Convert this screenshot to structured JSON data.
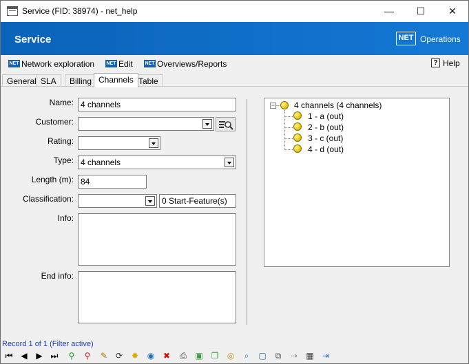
{
  "window": {
    "title": "Service (FID: 38974) - net_help",
    "minimize": "—",
    "maximize": "☐",
    "close": "✕"
  },
  "header": {
    "title": "Service",
    "logo_text": "NET",
    "product": "Operations",
    "colors": {
      "banner": "#0a63b8"
    }
  },
  "menu": {
    "items": [
      {
        "badge": "NET",
        "label": "Network exploration"
      },
      {
        "badge": "NET",
        "label": "Edit"
      },
      {
        "badge": "NET",
        "label": "Overviews/Reports"
      }
    ],
    "help_icon": "?",
    "help_label": "Help"
  },
  "tabs": [
    "General",
    "SLA",
    "Billing",
    "Channels",
    "Table"
  ],
  "active_tab": "Channels",
  "form": {
    "name": {
      "label": "Name:",
      "value": "4 channels"
    },
    "customer": {
      "label": "Customer:",
      "value": ""
    },
    "rating": {
      "label": "Rating:",
      "value": ""
    },
    "type": {
      "label": "Type:",
      "value": "4 channels"
    },
    "length": {
      "label": "Length (m):",
      "value": "84"
    },
    "classification": {
      "label": "Classification:",
      "value": "",
      "features": "0 Start-Feature(s)"
    },
    "info": {
      "label": "Info:",
      "value": ""
    },
    "end_info": {
      "label": "End info:",
      "value": ""
    }
  },
  "tree": {
    "root": {
      "expander": "−",
      "label": "4 channels (4 channels)"
    },
    "children": [
      "1 - a (out)",
      "2 - b (out)",
      "3 - c (out)",
      "4 - d (out)"
    ]
  },
  "status": "Record 1 of 1 (Filter active)",
  "toolbar": {
    "icons": [
      {
        "name": "first-record-icon",
        "glyph": "⏮"
      },
      {
        "name": "prev-record-icon",
        "glyph": "◀"
      },
      {
        "name": "next-record-icon",
        "glyph": "▶"
      },
      {
        "name": "last-record-icon",
        "glyph": "⏭"
      },
      {
        "name": "add-filter-icon",
        "glyph": "⚲"
      },
      {
        "name": "remove-filter-icon",
        "glyph": "⚲"
      },
      {
        "name": "edit-pencil-icon",
        "glyph": "✎"
      },
      {
        "name": "refresh-icon",
        "glyph": "⟳"
      },
      {
        "name": "new-record-icon",
        "glyph": "✸"
      },
      {
        "name": "globe-icon",
        "glyph": "◉"
      },
      {
        "name": "delete-icon",
        "glyph": "✖"
      },
      {
        "name": "print-icon",
        "glyph": "⎙"
      },
      {
        "name": "box-icon",
        "glyph": "▣"
      },
      {
        "name": "copy-box-icon",
        "glyph": "❐"
      },
      {
        "name": "locate-icon",
        "glyph": "◎"
      },
      {
        "name": "zoom-icon",
        "glyph": "⌕"
      },
      {
        "name": "select-icon",
        "glyph": "▢"
      },
      {
        "name": "duplicate-icon",
        "glyph": "⧉"
      },
      {
        "name": "move-icon",
        "glyph": "⇢"
      },
      {
        "name": "table-icon",
        "glyph": "▦"
      },
      {
        "name": "exit-icon",
        "glyph": "⇥"
      }
    ]
  }
}
